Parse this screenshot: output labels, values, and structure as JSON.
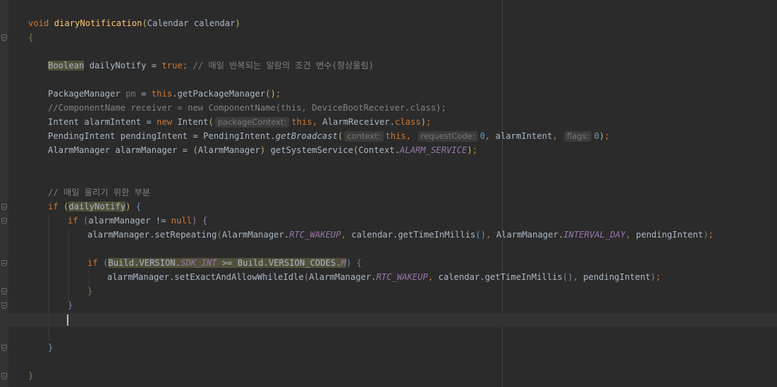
{
  "editor": {
    "tokens": {
      "void": "void",
      "method_name": "diaryNotification",
      "param_type": "Calendar",
      "param_name": "calendar",
      "open_brace": "{",
      "close_brace": "}",
      "boolean_type": "Boolean",
      "daily_notify": "dailyNotify",
      "true_kw": "true",
      "comment_daily": "// 매일 반복되는 알람의 조건 변수(항상울림)",
      "package_manager_type": "PackageManager",
      "pm": "pm",
      "this_kw": "this",
      "get_package_manager": "getPackageManager",
      "commented_component": "//ComponentName receiver = new ComponentName(this, DeviceBootReceiver.class);",
      "intent_type": "Intent",
      "alarm_intent": "alarmIntent",
      "new_kw": "new",
      "alarm_receiver": "AlarmReceiver",
      "class_kw": "class",
      "pending_intent_type": "PendingIntent",
      "pending_intent": "pendingIntent",
      "get_broadcast": "getBroadcast",
      "zero": "0",
      "alarm_manager_type": "AlarmManager",
      "alarm_manager": "alarmManager",
      "get_system_service": "getSystemService",
      "context": "Context",
      "alarm_service": "ALARM_SERVICE",
      "comment_ring": "// 매일 울리기 위한 부분",
      "if_kw": "if",
      "null_kw": "null",
      "set_repeating": "setRepeating",
      "rtc_wakeup": "RTC_WAKEUP",
      "get_time_in_millis": "getTimeInMillis",
      "interval_day": "INTERVAL_DAY",
      "build_version": "Build.VERSION",
      "sdk_int": "SDK_INT",
      "build_codes": "Build.VERSION_CODES",
      "m_const": "M",
      "set_exact": "setExactAndAllowWhileIdle"
    },
    "hints": {
      "package_context": "packageContext:",
      "context": "context:",
      "request_code": "requestCode:",
      "flags": "flags:"
    }
  }
}
